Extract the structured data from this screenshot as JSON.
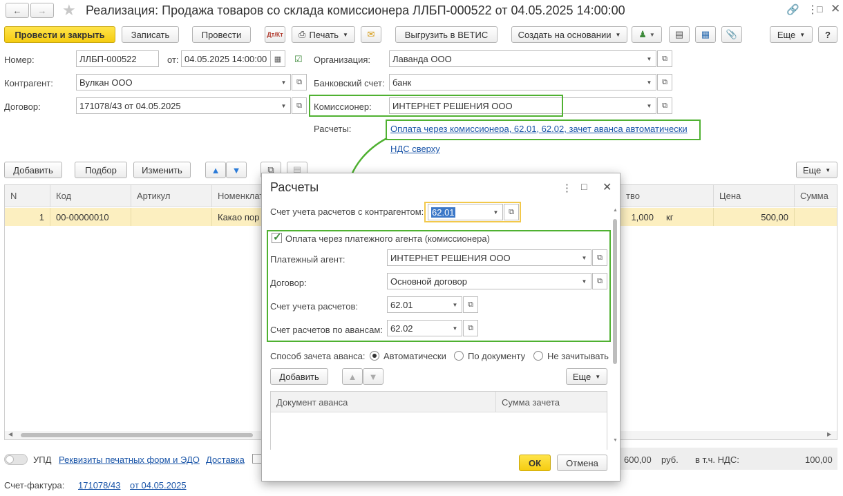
{
  "window": {
    "title": "Реализация: Продажа товаров со склада комиссионера ЛЛБП-000522 от 04.05.2025 14:00:00"
  },
  "toolbar": {
    "post_close": "Провести и закрыть",
    "save": "Записать",
    "post": "Провести",
    "dtkt": "Дт/Кт",
    "print": "Печать",
    "vetis": "Выгрузить в ВЕТИС",
    "create_based": "Создать на основании",
    "more": "Еще",
    "help": "?"
  },
  "form": {
    "number_label": "Номер:",
    "number_value": "ЛЛБП-000522",
    "date_label": "от:",
    "date_value": "04.05.2025 14:00:00",
    "org_label": "Организация:",
    "org_value": "Лаванда ООО",
    "contractor_label": "Контрагент:",
    "contractor_value": "Вулкан ООО",
    "bank_label": "Банковский счет:",
    "bank_value": "банк",
    "contract_label": "Договор:",
    "contract_value": "171078/43 от 04.05.2025",
    "commissioner_label": "Комиссионер:",
    "commissioner_value": "ИНТЕРНЕТ РЕШЕНИЯ ООО",
    "settlements_label": "Расчеты:",
    "settlements_link": "Оплата через комиссионера, 62.01, 62.02, зачет аванса автоматически",
    "vat_link": "НДС сверху"
  },
  "table_toolbar": {
    "add": "Добавить",
    "pick": "Подбор",
    "edit": "Изменить",
    "more": "Еще"
  },
  "table": {
    "columns": [
      "N",
      "Код",
      "Артикул",
      "Номенклат",
      "тво",
      "Цена",
      "Сумма"
    ],
    "rows": [
      {
        "n": "1",
        "code": "00-00000010",
        "article": "",
        "name": "Какао пор",
        "qty": "1,000",
        "unit": "кг",
        "price": "500,00",
        "sum": ""
      }
    ]
  },
  "footer": {
    "upd_label": "УПД",
    "print_forms_link": "Реквизиты печатных форм и ЭДО",
    "delivery_link": "Доставка",
    "total": "600,00",
    "currency": "руб.",
    "vat_label": "в т.ч. НДС:",
    "vat_value": "100,00",
    "invoice_label": "Счет-фактура:",
    "invoice_link_num": "171078/43",
    "invoice_link_date": "от 04.05.2025"
  },
  "dialog": {
    "title": "Расчеты",
    "account_label": "Счет учета расчетов с контрагентом:",
    "account_value": "62.01",
    "agent_check_label": "Оплата через платежного агента (комиссионера)",
    "agent_label": "Платежный агент:",
    "agent_value": "ИНТЕРНЕТ РЕШЕНИЯ ООО",
    "contract_label": "Договор:",
    "contract_value": "Основной договор",
    "settle_acc_label": "Счет учета расчетов:",
    "settle_acc_value": "62.01",
    "advance_acc_label": "Счет расчетов по авансам:",
    "advance_acc_value": "62.02",
    "offset_label": "Способ зачета аванса:",
    "offset_auto": "Автоматически",
    "offset_doc": "По документу",
    "offset_none": "Не зачитывать",
    "add": "Добавить",
    "more": "Еще",
    "col_doc": "Документ аванса",
    "col_sum": "Сумма зачета",
    "ok": "ОК",
    "cancel": "Отмена"
  }
}
